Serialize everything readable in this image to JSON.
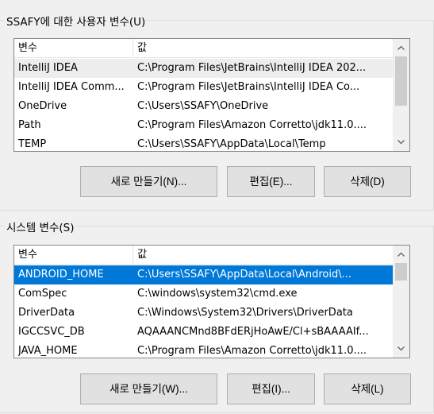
{
  "user_section": {
    "title": "SSAFY에 대한 사용자 변수(U)",
    "columns": [
      "변수",
      "값"
    ],
    "rows": [
      {
        "name": "IntelliJ IDEA",
        "value": "C:\\Program Files\\JetBrains\\IntelliJ IDEA 202..."
      },
      {
        "name": "IntelliJ IDEA Comm...",
        "value": "C:\\Program Files\\JetBrains\\IntelliJ IDEA Co..."
      },
      {
        "name": "OneDrive",
        "value": "C:\\Users\\SSAFY\\OneDrive"
      },
      {
        "name": "Path",
        "value": "C:\\Program Files\\Amazon Corretto\\jdk11.0...."
      },
      {
        "name": "TEMP",
        "value": "C:\\Users\\SSAFY\\AppData\\Local\\Temp"
      }
    ],
    "buttons": {
      "new": "새로 만들기(N)...",
      "edit": "편집(E)...",
      "delete": "삭제(D)"
    }
  },
  "system_section": {
    "title": "시스템 변수(S)",
    "columns": [
      "변수",
      "값"
    ],
    "rows": [
      {
        "name": "ANDROID_HOME",
        "value": "C:\\Users\\SSAFY\\AppData\\Local\\Android\\..."
      },
      {
        "name": "ComSpec",
        "value": "C:\\windows\\system32\\cmd.exe"
      },
      {
        "name": "DriverData",
        "value": "C:\\Windows\\System32\\Drivers\\DriverData"
      },
      {
        "name": "IGCCSVC_DB",
        "value": "AQAAANCMnd8BFdERjHoAwE/Cl+sBAAAAIf..."
      },
      {
        "name": "JAVA_HOME",
        "value": "C:\\Program Files\\Amazon Corretto\\jdk11.0...."
      }
    ],
    "buttons": {
      "new": "새로 만들기(W)...",
      "edit": "편집(I)...",
      "delete": "삭제(L)"
    }
  },
  "icons": {
    "up": "chevron-up-icon",
    "down": "chevron-down-icon"
  }
}
